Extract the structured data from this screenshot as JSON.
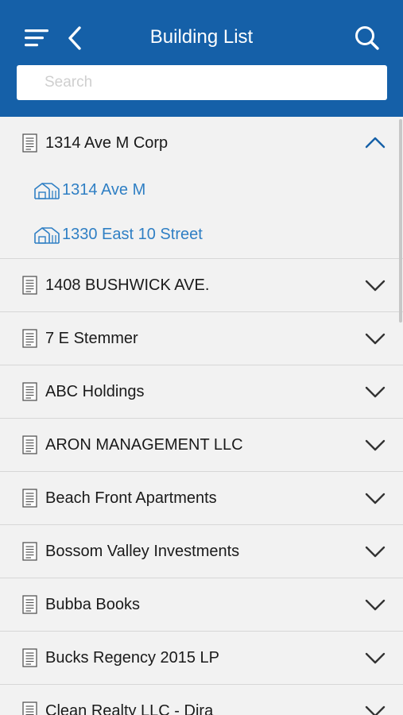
{
  "header": {
    "title": "Building List",
    "color": "#1560a8",
    "menu_icon": "hamburger-icon",
    "back_icon": "chevron-left-icon",
    "search_icon": "search-icon"
  },
  "search": {
    "placeholder": "Search",
    "value": ""
  },
  "list": {
    "expanded": {
      "label": "1314 Ave M Corp",
      "buildings": [
        "1314 Ave M",
        "1330 East 10 Street"
      ]
    },
    "collapsed": [
      "1408 BUSHWICK AVE.",
      "7 E Stemmer",
      "ABC Holdings",
      "ARON MANAGEMENT LLC",
      "Beach Front Apartments",
      "Bossom Valley Investments",
      "Bubba Books",
      "Bucks Regency 2015 LP",
      "Clean Realty LLC - Dira"
    ]
  },
  "colors": {
    "accent": "#2f7fc4",
    "chevron": "#1560a8"
  }
}
